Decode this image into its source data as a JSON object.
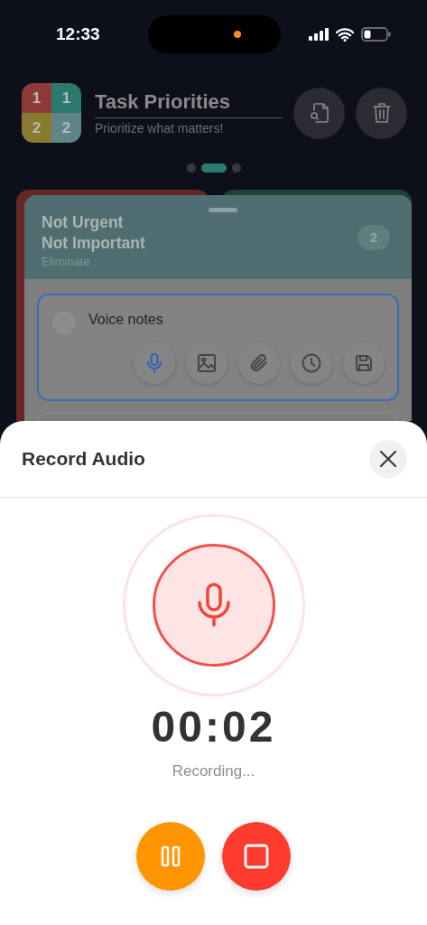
{
  "status_bar": {
    "time": "12:33"
  },
  "header": {
    "logo": [
      {
        "label": "1",
        "color": "#8f3a3a"
      },
      {
        "label": "1",
        "color": "#2c7a6e"
      },
      {
        "label": "2",
        "color": "#8a7a30"
      },
      {
        "label": "2",
        "color": "#5f8588"
      }
    ],
    "title": "Task Priorities",
    "subtitle": "Prioritize what matters!"
  },
  "pages": [
    {
      "selected": false
    },
    {
      "selected": true
    },
    {
      "selected": false
    }
  ],
  "quadrant": {
    "title_lines": [
      "Not Urgent",
      "Not Important"
    ],
    "action": "Eliminate",
    "count": "2",
    "task": {
      "text": "Voice notes",
      "checked": false,
      "tools": [
        {
          "kind": "mic",
          "selected": true
        },
        {
          "kind": "image",
          "selected": false
        },
        {
          "kind": "attach",
          "selected": false
        },
        {
          "kind": "clock",
          "selected": false
        },
        {
          "kind": "save",
          "selected": false
        }
      ]
    }
  },
  "sheet": {
    "title": "Record Audio",
    "timer": "00:02",
    "status": "Recording...",
    "controls": [
      {
        "kind": "pause"
      },
      {
        "kind": "stop"
      }
    ]
  }
}
